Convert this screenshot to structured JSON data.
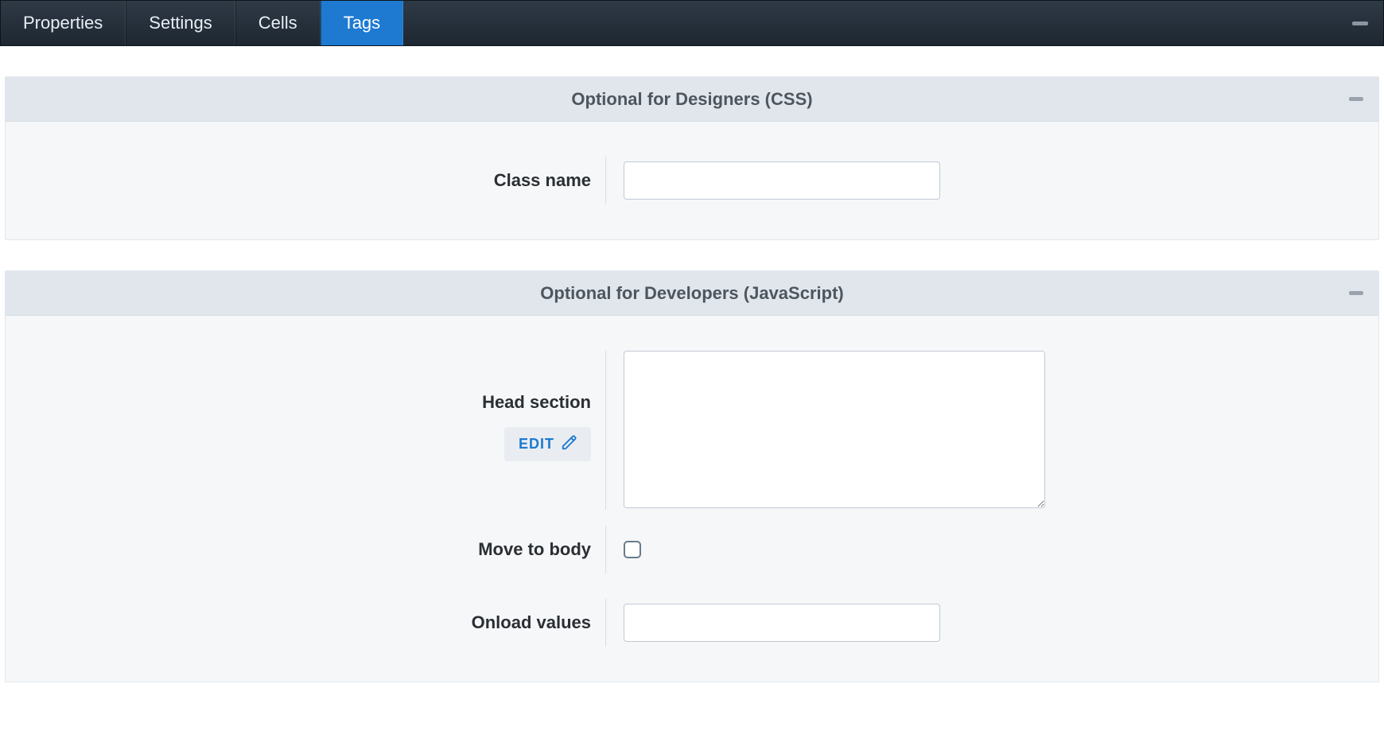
{
  "tabs": [
    {
      "label": "Properties",
      "active": false
    },
    {
      "label": "Settings",
      "active": false
    },
    {
      "label": "Cells",
      "active": false
    },
    {
      "label": "Tags",
      "active": true
    }
  ],
  "panels": {
    "designers": {
      "title": "Optional for Designers  (CSS)",
      "fields": {
        "class_name": {
          "label": "Class name",
          "value": ""
        }
      }
    },
    "developers": {
      "title": "Optional for Developers  (JavaScript)",
      "edit_label": "EDIT",
      "fields": {
        "head_section": {
          "label": "Head section",
          "value": ""
        },
        "move_to_body": {
          "label": "Move to body",
          "checked": false
        },
        "onload_values": {
          "label": "Onload values",
          "value": ""
        }
      }
    }
  }
}
